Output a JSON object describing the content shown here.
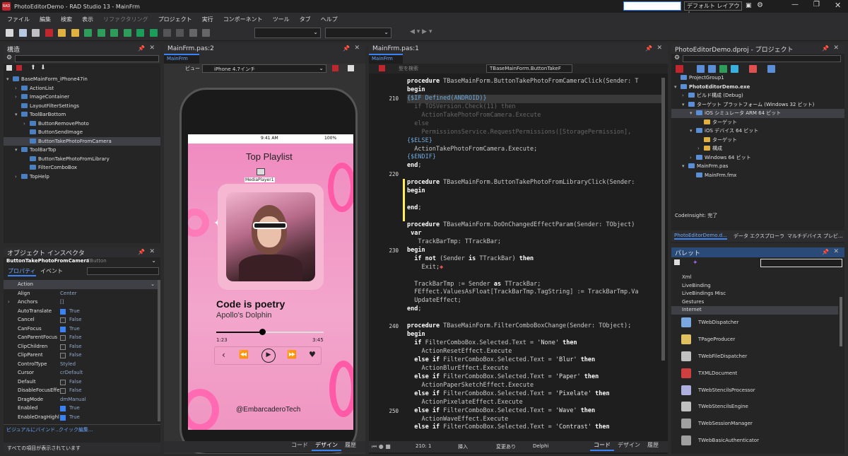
{
  "window": {
    "title": "PhotoEditorDemo - RAD Studio 13 - MainFrm",
    "layout_value": "デフォルト レイアウト"
  },
  "menu": [
    "ファイル",
    "編集",
    "検索",
    "表示",
    "リファクタリング",
    "プロジェクト",
    "実行",
    "コンポーネント",
    "ツール",
    "タブ",
    "ヘルプ"
  ],
  "structure": {
    "title": "構造",
    "items": [
      {
        "label": "BaseMainForm_iPhone47in",
        "level": 0,
        "exp": "▾"
      },
      {
        "label": "ActionList",
        "level": 1,
        "exp": "›"
      },
      {
        "label": "ImageContainer",
        "level": 1,
        "exp": "›"
      },
      {
        "label": "LayoutFilterSettings",
        "level": 1,
        "exp": ""
      },
      {
        "label": "ToolBarBottom",
        "level": 1,
        "exp": "▾"
      },
      {
        "label": "ButtonRemovePhoto",
        "level": 2,
        "exp": "›"
      },
      {
        "label": "ButtonSendImage",
        "level": 2,
        "exp": ""
      },
      {
        "label": "ButtonTakePhotoFromCamera",
        "level": 2,
        "exp": "",
        "sel": true
      },
      {
        "label": "ToolBarTop",
        "level": 1,
        "exp": "▾"
      },
      {
        "label": "ButtonTakePhotoFromLibrary",
        "level": 2,
        "exp": ""
      },
      {
        "label": "FilterComboBox",
        "level": 2,
        "exp": ""
      },
      {
        "label": "TopHelp",
        "level": 1,
        "exp": "›"
      }
    ]
  },
  "inspector": {
    "title": "オブジェクト インスペクタ",
    "object_name": "ButtonTakePhotoFromCamera",
    "object_type": "TButton",
    "tab_props": "プロパティ",
    "tab_events": "イベント",
    "rows": [
      {
        "name": "Action",
        "value": "",
        "sel": true
      },
      {
        "name": "Align",
        "value": "Center"
      },
      {
        "name": "Anchors",
        "value": "[]",
        "exp": true
      },
      {
        "name": "AutoTranslate",
        "check": true,
        "value": "True"
      },
      {
        "name": "Cancel",
        "check": false,
        "value": "False"
      },
      {
        "name": "CanFocus",
        "check": true,
        "value": "True"
      },
      {
        "name": "CanParentFocus",
        "check": false,
        "value": "False"
      },
      {
        "name": "ClipChildren",
        "check": false,
        "value": "False"
      },
      {
        "name": "ClipParent",
        "check": false,
        "value": "False"
      },
      {
        "name": "ControlType",
        "value": "Styled"
      },
      {
        "name": "Cursor",
        "value": "crDefault"
      },
      {
        "name": "Default",
        "check": false,
        "value": "False"
      },
      {
        "name": "DisableFocusEffe",
        "check": false,
        "value": "False"
      },
      {
        "name": "DragMode",
        "value": "dmManual"
      },
      {
        "name": "Enabled",
        "check": true,
        "value": "True"
      },
      {
        "name": "EnableDragHighl",
        "check": true,
        "value": "True"
      }
    ],
    "link1": "ビジュアルにバインド...",
    "link2": "クイック編集...",
    "status": "すべての項目が表示されています"
  },
  "designer": {
    "pane_title": "MainFrm.pas:2",
    "tab": "MainFrm",
    "view_label": "ビュー :",
    "view_value": "iPhone 4.7インチ",
    "phone": {
      "time": "9:41 AM",
      "battery": "100%",
      "header": "Top Playlist",
      "mediaplayer": "MediaPlayer1",
      "song": "Code is poetry",
      "artist": "Apollo's Dolphin",
      "elapsed": "1:23",
      "total": "3:45",
      "progress": 0.43,
      "handle": "@EmbarcaderoTech"
    },
    "bottom_tabs": [
      "コード",
      "デザイン",
      "履歴"
    ]
  },
  "editor": {
    "pane_title": "MainFrm.pas:1",
    "tab": "MainFrm",
    "search_placeholder": "型を検索",
    "method_combo": "TBaseMainForm.ButtonTakeF",
    "gutter": [
      "",
      "",
      "210",
      "",
      "",
      "",
      "",
      "",
      "",
      "",
      "",
      "220",
      "",
      "",
      "",
      "",
      "",
      "",
      "",
      "",
      "230",
      "",
      "",
      "",
      "",
      "",
      "",
      "",
      "",
      "240",
      "",
      "",
      "",
      "",
      "",
      "",
      "",
      "",
      "",
      "250"
    ],
    "status_pos": "210:  1",
    "status_mode": "挿入",
    "status_changed": "変更あり",
    "status_lang": "Delphi",
    "bottom_tabs": [
      "コード",
      "デザイン",
      "履歴"
    ]
  },
  "project": {
    "title": "PhotoEditorDemo.dproj - プロジェクト",
    "items": [
      {
        "label": "ProjectGroup1",
        "level": 0,
        "exp": ""
      },
      {
        "label": "PhotoEditorDemo.exe",
        "level": 0,
        "exp": "▾",
        "bold": true
      },
      {
        "label": "ビルド構成 (Debug)",
        "level": 1,
        "exp": "›"
      },
      {
        "label": "ターゲット プラットフォーム (Windows 32 ビット)",
        "level": 1,
        "exp": "▾"
      },
      {
        "label": "iOS シミュレータ ARM 64 ビット",
        "level": 2,
        "exp": "▾",
        "sel": true
      },
      {
        "label": "ターゲット",
        "level": 3,
        "exp": ""
      },
      {
        "label": "iOS デバイス 64 ビット",
        "level": 2,
        "exp": "▾"
      },
      {
        "label": "ターゲット",
        "level": 3,
        "exp": ""
      },
      {
        "label": "構成",
        "level": 3,
        "exp": "›"
      },
      {
        "label": "Windows 64 ビット",
        "level": 2,
        "exp": "›"
      },
      {
        "label": "MainFrm.pas",
        "level": 1,
        "exp": "▾"
      },
      {
        "label": "MainFrm.fmx",
        "level": 2,
        "exp": ""
      }
    ],
    "codeinsight": "CodeInsight: 完了",
    "tabs": [
      "PhotoEditorDemo.d...",
      "データ エクスプローラ",
      "マルチデバイス プレビ..."
    ]
  },
  "palette": {
    "title": "パレット",
    "categories": [
      "Xml",
      "LiveBinding",
      "LiveBindings Misc",
      "Gestures"
    ],
    "open_category": "Internet",
    "items": [
      "TWebDispatcher",
      "TPageProducer",
      "TWebFileDispatcher",
      "TXMLDocument",
      "TWebStencilsProcessor",
      "TWebStencilsEngine",
      "TWebSessionManager",
      "TWebBasicAuthenticator"
    ]
  },
  "colors": {
    "accent": "#3b82f6",
    "phone_bg": "#f0a6c8",
    "phone_card": "#f6b7d2"
  }
}
